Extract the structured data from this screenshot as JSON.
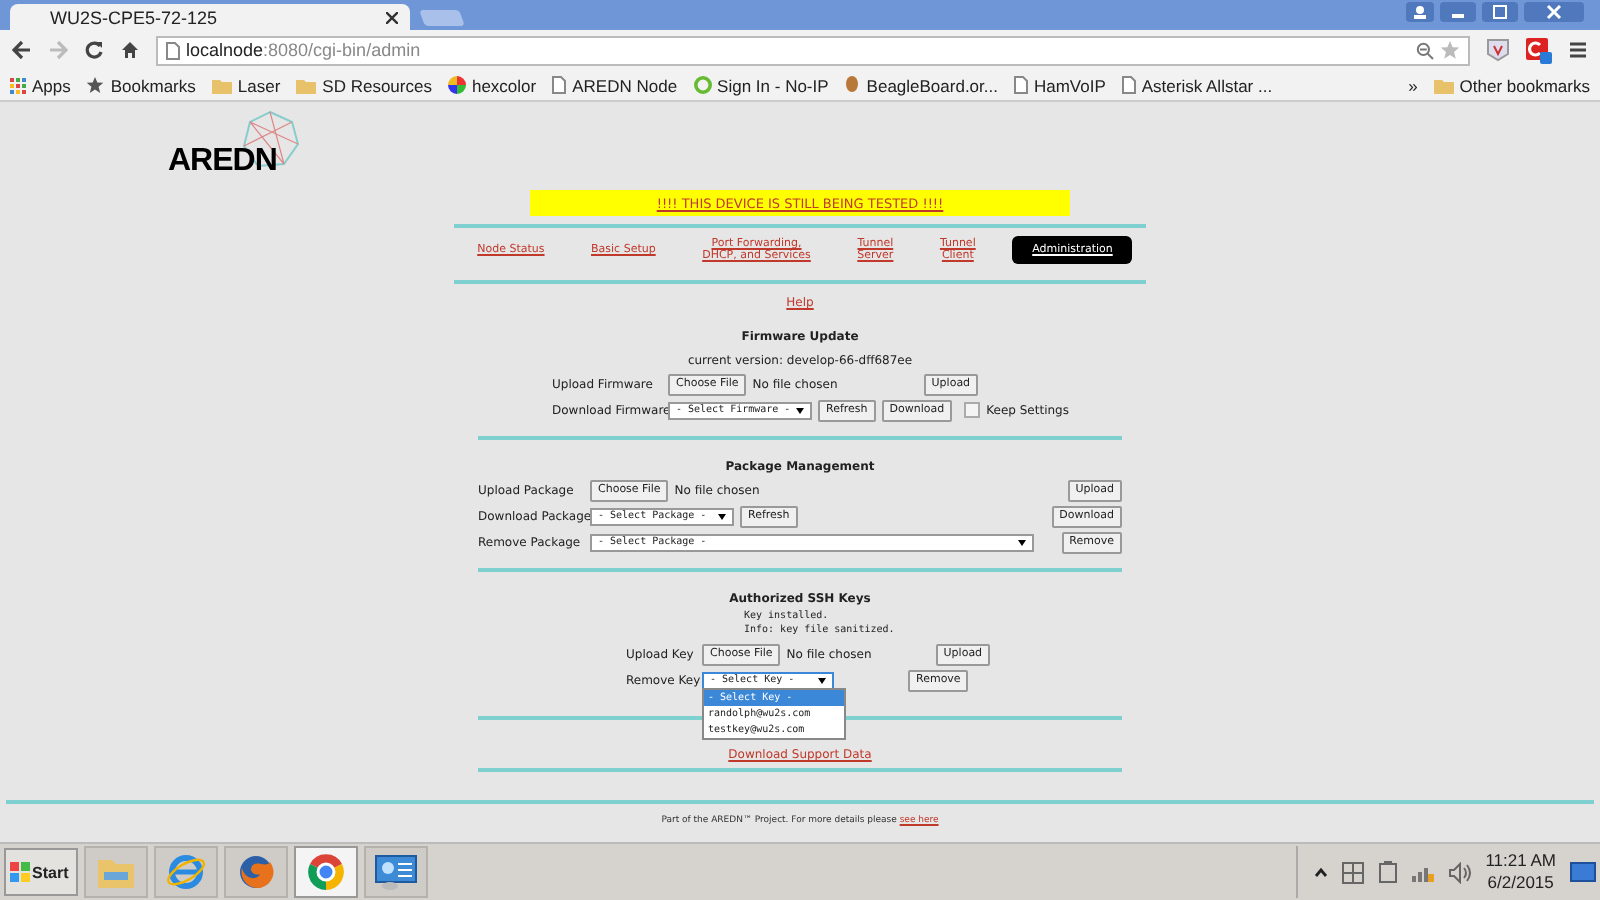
{
  "browser": {
    "tab_title": "WU2S-CPE5-72-125",
    "url_host": "localnode",
    "url_path": ":8080/cgi-bin/admin",
    "bookmarks": [
      {
        "kind": "apps",
        "label": "Apps"
      },
      {
        "kind": "star",
        "label": "Bookmarks"
      },
      {
        "kind": "folder",
        "label": "Laser"
      },
      {
        "kind": "folder",
        "label": "SD Resources"
      },
      {
        "kind": "color",
        "label": "hexcolor"
      },
      {
        "kind": "page",
        "label": "AREDN Node"
      },
      {
        "kind": "noip",
        "label": "Sign In - No-IP"
      },
      {
        "kind": "beagle",
        "label": "BeagleBoard.or..."
      },
      {
        "kind": "page",
        "label": "HamVoIP"
      },
      {
        "kind": "page",
        "label": "Asterisk Allstar ..."
      }
    ],
    "overflow": "»",
    "other_bookmarks": "Other bookmarks"
  },
  "page": {
    "logo": "AREDN",
    "banner": "!!!! THIS DEVICE IS STILL BEING TESTED !!!!",
    "nav": [
      {
        "label": "Node Status",
        "selected": false
      },
      {
        "label": "Basic Setup",
        "selected": false
      },
      {
        "label": "Port Forwarding,\nDHCP, and Services",
        "selected": false
      },
      {
        "label": "Tunnel\nServer",
        "selected": false
      },
      {
        "label": "Tunnel\nClient",
        "selected": false
      },
      {
        "label": "Administration",
        "selected": true
      }
    ],
    "help": "Help",
    "firmware": {
      "title": "Firmware Update",
      "version": "current version: develop-66-dff687ee",
      "upload_label": "Upload Firmware",
      "choose": "Choose File",
      "no_file": "No file chosen",
      "upload": "Upload",
      "download_label": "Download Firmware",
      "select": "- Select Firmware -",
      "refresh": "Refresh",
      "download": "Download",
      "keep": {
        "label": "Keep Settings",
        "checked": false
      }
    },
    "packages": {
      "title": "Package Management",
      "upload_label": "Upload Package",
      "choose": "Choose File",
      "no_file": "No file chosen",
      "upload": "Upload",
      "download_label": "Download Package",
      "select": "- Select Package -",
      "refresh": "Refresh",
      "download": "Download",
      "remove_label": "Remove Package",
      "remove_select": "- Select Package -",
      "remove": "Remove"
    },
    "ssh": {
      "title": "Authorized SSH Keys",
      "messages": [
        "Key installed.",
        "Info: key file sanitized."
      ],
      "upload_label": "Upload Key",
      "choose": "Choose File",
      "no_file": "No file chosen",
      "upload": "Upload",
      "remove_label": "Remove Key",
      "select": "- Select Key -",
      "remove": "Remove",
      "options": [
        {
          "label": "- Select Key -",
          "selected": true
        },
        {
          "label": "randolph@wu2s.com",
          "selected": false
        },
        {
          "label": "testkey@wu2s.com",
          "selected": false
        }
      ]
    },
    "support_link": "Download Support Data",
    "footer": "Part of the AREDN™ Project. For more details please ",
    "footer_link": "see here"
  },
  "taskbar": {
    "start": "Start",
    "apps": [
      {
        "kind": "explorer",
        "selected": false
      },
      {
        "kind": "ie",
        "selected": false
      },
      {
        "kind": "firefox",
        "selected": false
      },
      {
        "kind": "chrome",
        "selected": true
      },
      {
        "kind": "control",
        "selected": false
      }
    ],
    "time": "11:21 AM",
    "date": "6/2/2015"
  }
}
